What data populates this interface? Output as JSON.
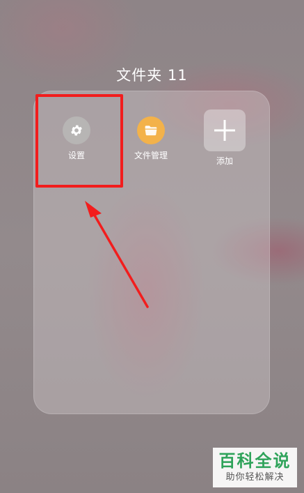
{
  "folder": {
    "title": "文件夹 11"
  },
  "apps": [
    {
      "label": "设置",
      "icon": "gear-icon"
    },
    {
      "label": "文件管理",
      "icon": "folder-icon"
    },
    {
      "label": "添加",
      "icon": "plus-icon"
    }
  ],
  "annotation": {
    "box_color": "#f21d1d",
    "arrow_color": "#f21d1d"
  },
  "watermark": {
    "main": "百科全说",
    "sub": "助你轻松解决"
  }
}
